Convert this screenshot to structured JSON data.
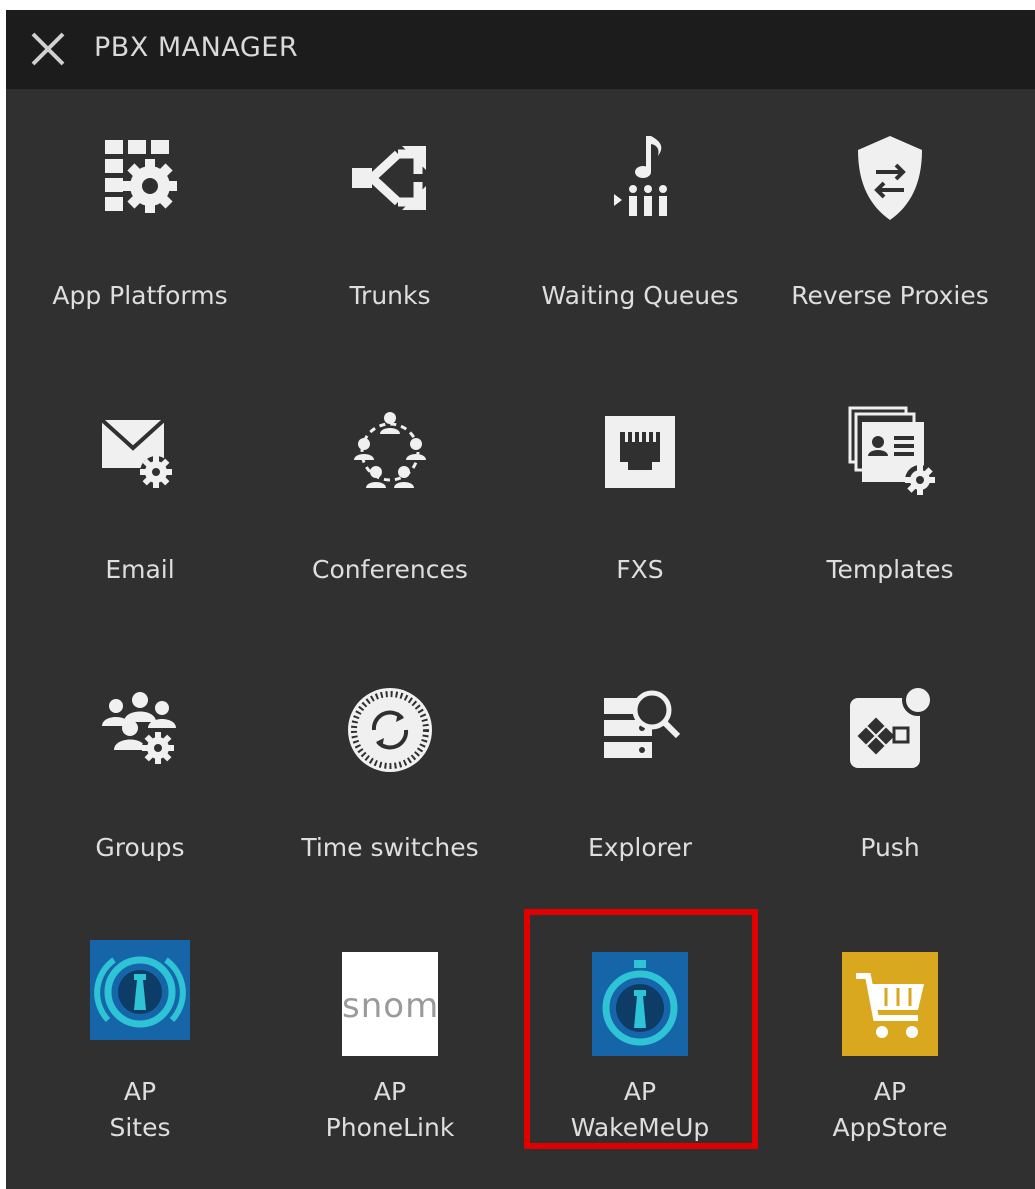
{
  "header": {
    "title": "PBX MANAGER"
  },
  "tiles": [
    {
      "label": "App Platforms"
    },
    {
      "label": "Trunks"
    },
    {
      "label": "Waiting Queues"
    },
    {
      "label": "Reverse Proxies"
    },
    {
      "label": "Email"
    },
    {
      "label": "Conferences"
    },
    {
      "label": "FXS"
    },
    {
      "label": "Templates"
    },
    {
      "label": "Groups"
    },
    {
      "label": "Time switches"
    },
    {
      "label": "Explorer"
    },
    {
      "label": "Push"
    },
    {
      "label": "AP\nSites"
    },
    {
      "label": "AP\nPhoneLink"
    },
    {
      "label": "AP\nWakeMeUp"
    },
    {
      "label": "AP\nAppStore"
    }
  ],
  "snom_logo_text": "snom",
  "colors": {
    "panel": "#303030",
    "header": "#1c1c1c",
    "icon": "#f0f0f0",
    "highlight": "#e00000",
    "ap_blue": "#1565a8",
    "ap_teal": "#2ec4d6",
    "appstore_gold": "#d9a81e"
  }
}
